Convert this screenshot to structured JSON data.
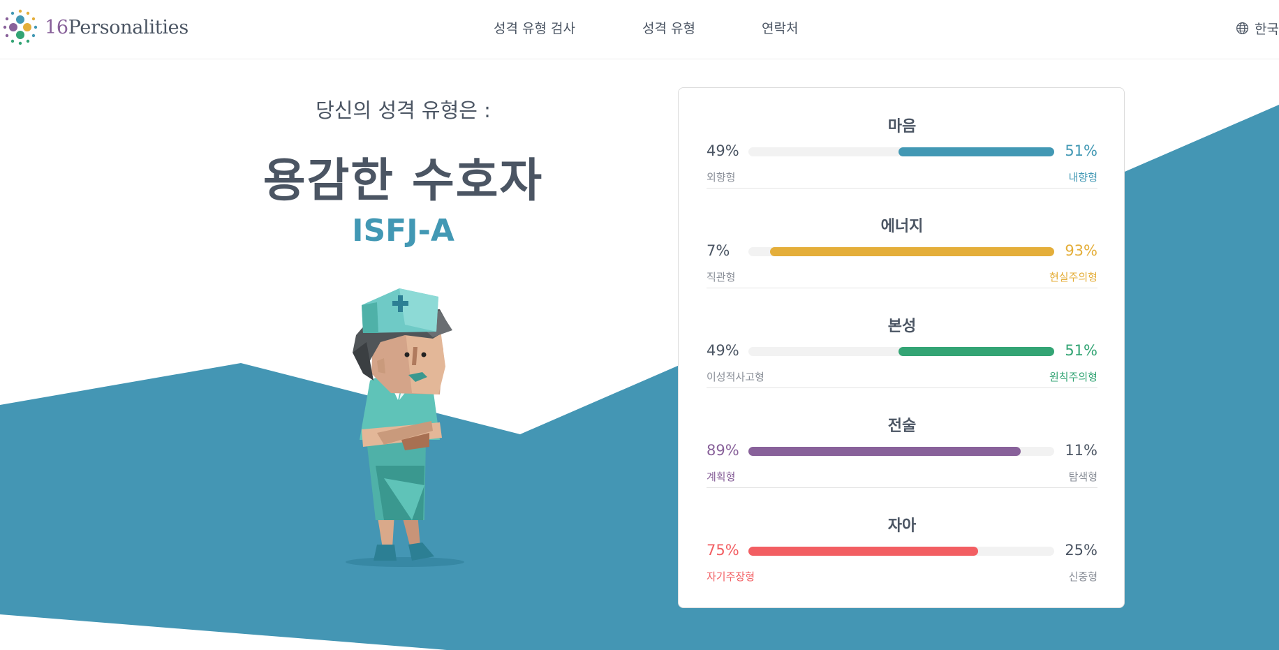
{
  "header": {
    "logo_number": "16",
    "logo_word": "Personalities",
    "nav": [
      "성격 유형 검사",
      "성격 유형",
      "연락처"
    ],
    "language": "한국"
  },
  "hero": {
    "intro": "당신의 성격 유형은 :",
    "type_name": "용감한 수호자",
    "type_code": "ISFJ-A"
  },
  "colors": {
    "mind": "#4298b4",
    "energy": "#e4ae3a",
    "nature": "#33a474",
    "tactics": "#88619a",
    "identity": "#f25e62",
    "background_shape": "#4496b4"
  },
  "traits": [
    {
      "title": "마음",
      "left_pct": "49%",
      "right_pct": "51%",
      "left_label": "외향형",
      "right_label": "내향형",
      "winner": "right",
      "winner_fraction": 0.51,
      "color_key": "mind"
    },
    {
      "title": "에너지",
      "left_pct": "7%",
      "right_pct": "93%",
      "left_label": "직관형",
      "right_label": "현실주의형",
      "winner": "right",
      "winner_fraction": 0.93,
      "color_key": "energy"
    },
    {
      "title": "본성",
      "left_pct": "49%",
      "right_pct": "51%",
      "left_label": "이성적사고형",
      "right_label": "원칙주의형",
      "winner": "right",
      "winner_fraction": 0.51,
      "color_key": "nature"
    },
    {
      "title": "전술",
      "left_pct": "89%",
      "right_pct": "11%",
      "left_label": "계획형",
      "right_label": "탐색형",
      "winner": "left",
      "winner_fraction": 0.89,
      "color_key": "tactics"
    },
    {
      "title": "자아",
      "left_pct": "75%",
      "right_pct": "25%",
      "left_label": "자기주장형",
      "right_label": "신중형",
      "winner": "left",
      "winner_fraction": 0.75,
      "color_key": "identity"
    }
  ]
}
